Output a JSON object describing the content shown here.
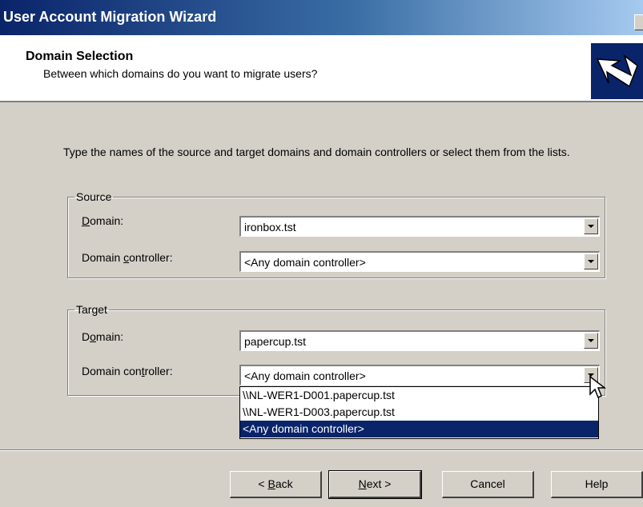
{
  "window": {
    "title": "User Account Migration Wizard"
  },
  "header": {
    "title": "Domain Selection",
    "subtitle": "Between which domains do you want to migrate users?",
    "icon": "wizard-arrow-icon"
  },
  "intro": "Type the names of the source and target domains and domain controllers or select them from the lists.",
  "source": {
    "legend": "Source",
    "domain_label_pre": "",
    "domain_label_key": "D",
    "domain_label_post": "omain:",
    "domain_value": "ironbox.tst",
    "dc_label_pre": "Domain ",
    "dc_label_key": "c",
    "dc_label_post": "ontroller:",
    "dc_value": "<Any domain controller>"
  },
  "target": {
    "legend": "Target",
    "domain_label_pre": "D",
    "domain_label_key": "o",
    "domain_label_post": "main:",
    "domain_value": "papercup.tst",
    "dc_label_pre": "Domain con",
    "dc_label_key": "t",
    "dc_label_post": "roller:",
    "dc_value": "<Any domain controller>"
  },
  "dropdown": {
    "options": [
      "\\\\NL-WER1-D001.papercup.tst",
      "\\\\NL-WER1-D003.papercup.tst",
      "<Any domain controller>"
    ],
    "selected_index": 2
  },
  "buttons": {
    "back_pre": "< ",
    "back_key": "B",
    "back_post": "ack",
    "next_key": "N",
    "next_post": "ext >",
    "cancel": "Cancel",
    "help": "Help"
  },
  "colors": {
    "title_start": "#0a246a",
    "title_end": "#a6caf0",
    "selection": "#0a246a",
    "face": "#d4d0c8"
  }
}
